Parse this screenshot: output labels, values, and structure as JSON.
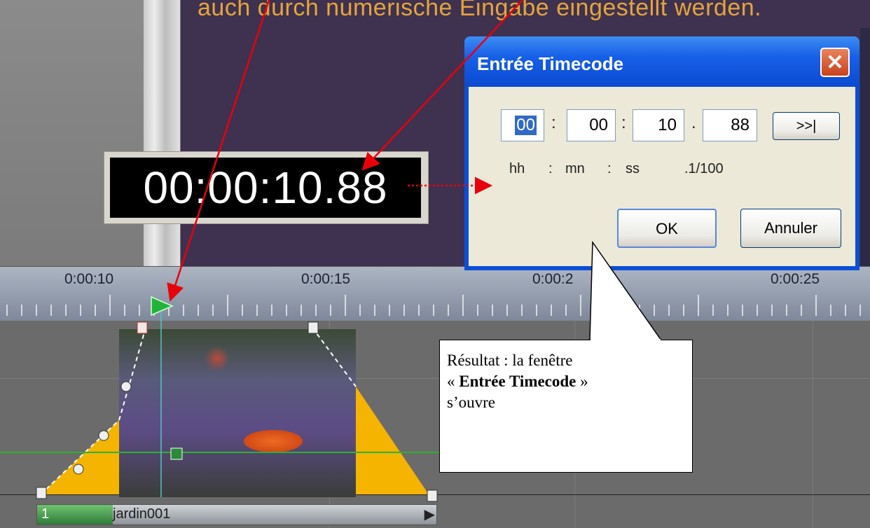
{
  "preview": {
    "caption": "auch durch numerische Eingabe eingestellt werden."
  },
  "timecode_display": {
    "value": "00:00:10.88"
  },
  "ruler": {
    "labels": [
      "0:00:10",
      "0:00:15",
      "0:00:2",
      "0:00:25"
    ]
  },
  "clip": {
    "number": "1",
    "name": "jardin001",
    "end_marker": "▶"
  },
  "dialog": {
    "title": "Entrée Timecode",
    "close_label": "✕",
    "fields": {
      "hh": "00",
      "mn": "00",
      "ss": "10",
      "cs": "88"
    },
    "separators": [
      ":",
      ":",
      "."
    ],
    "format_labels": [
      "hh",
      ":",
      "mn",
      ":",
      "ss",
      ".1/100"
    ],
    "goto_label": ">>|",
    "ok_label": "OK",
    "cancel_label": "Annuler"
  },
  "callout": {
    "line1": "Résultat : la fenêtre",
    "open_quote": "« ",
    "bold_text": "Entrée Timecode",
    "close_quote": " »",
    "line3": "s’ouvre"
  },
  "colors": {
    "preview_bg": "#3f3150",
    "caption": "#e4a63a",
    "arrow": "#e8000a",
    "dialog_titlebar": "#0a4ad0",
    "envelope_yellow": "#f4b400"
  }
}
